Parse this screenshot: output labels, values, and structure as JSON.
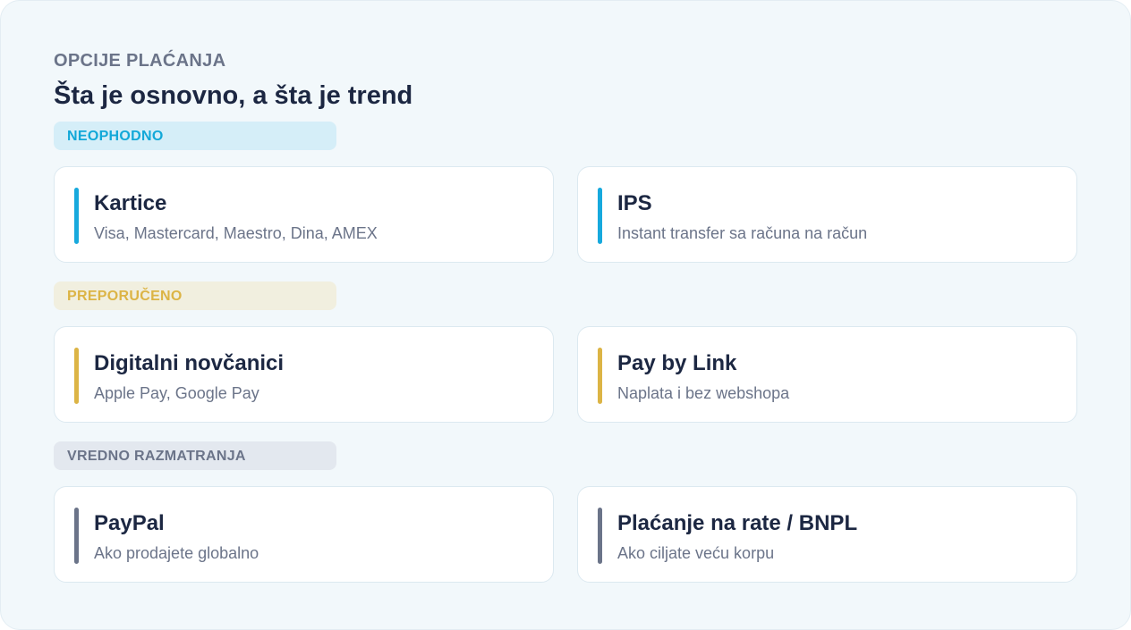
{
  "header": {
    "eyebrow": "OPCIJE PLAĆANJA",
    "title": "Šta je osnovno, a šta je trend"
  },
  "colors": {
    "essential": "#17a9dd",
    "recommended": "#dcb445",
    "consider": "#6b7489"
  },
  "sections": [
    {
      "badge": "NEOPHODNO",
      "cards": [
        {
          "title": "Kartice",
          "description": "Visa, Mastercard, Maestro, Dina, AMEX"
        },
        {
          "title": "IPS",
          "description": "Instant transfer sa računa na račun"
        }
      ]
    },
    {
      "badge": "PREPORUČENO",
      "cards": [
        {
          "title": "Digitalni novčanici",
          "description": "Apple Pay, Google Pay"
        },
        {
          "title": "Pay by Link",
          "description": "Naplata i bez webshopa"
        }
      ]
    },
    {
      "badge": "VREDNO RAZMATRANJA",
      "cards": [
        {
          "title": "PayPal",
          "description": "Ako prodajete globalno"
        },
        {
          "title": "Plaćanje na rate / BNPL",
          "description": "Ako ciljate veću korpu"
        }
      ]
    }
  ]
}
